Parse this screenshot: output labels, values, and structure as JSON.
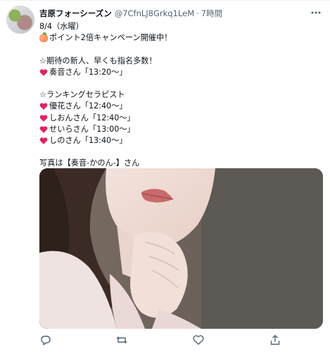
{
  "author": {
    "name": "吉原フォーシーズン",
    "handle": "@7CfnLJ8Grkq1LeM",
    "separator": "·",
    "time": "7時間"
  },
  "tweet": {
    "lines": [
      "8/4（水曜）",
      "ポイント2倍キャンペーン開催中！",
      "",
      "☆期待の新人、早くも指名多数！",
      "奏音さん「13:20～」",
      "",
      "☆ランキングセラピスト",
      "優花さん「12:40～」",
      "しおんさん「12:40～」",
      "せいらさん「13:00～」",
      "しのさん「13:40～」",
      "",
      "写真は【奏音-かのん-】さん"
    ]
  },
  "icons": {
    "more": "more-icon",
    "reply": "reply-icon",
    "retweet": "retweet-icon",
    "like": "heart-icon",
    "share": "share-icon"
  },
  "colors": {
    "text": "#0f1419",
    "secondary": "#536471",
    "heart": "#e0245e"
  }
}
